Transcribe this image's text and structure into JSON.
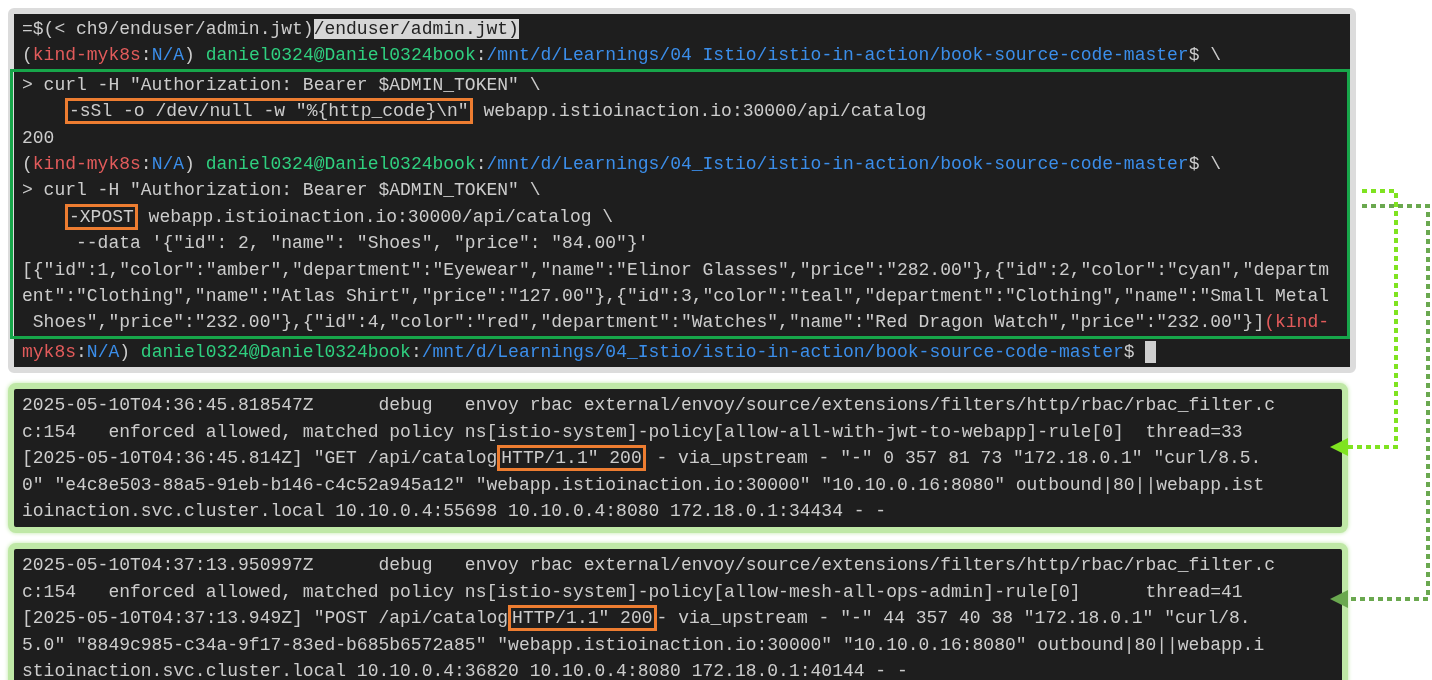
{
  "command_terminal": {
    "blocks": [
      {
        "framed": false,
        "lines": [
          [
            {
              "kind": "text",
              "text": "=$(< ch9/enduser/admin.jwt)"
            },
            {
              "kind": "selected",
              "text": "/enduser/admin.jwt)"
            }
          ],
          [
            {
              "kind": "text",
              "text": "("
            },
            {
              "kind": "env",
              "text": "kind-myk8s"
            },
            {
              "kind": "text",
              "text": ":"
            },
            {
              "kind": "ctx",
              "text": "N/A"
            },
            {
              "kind": "text",
              "text": ") "
            },
            {
              "kind": "user",
              "text": "daniel0324@Daniel0324book"
            },
            {
              "kind": "text",
              "text": ":"
            },
            {
              "kind": "path",
              "text": "/mnt/d/Learnings/04 Istio/istio-in-action/book-source-code-master"
            },
            {
              "kind": "text",
              "text": "$ \\"
            }
          ]
        ]
      },
      {
        "framed": true,
        "lines": [
          [
            {
              "kind": "text",
              "text": "> curl -H \"Authorization: Bearer $ADMIN_TOKEN\" \\"
            }
          ],
          [
            {
              "kind": "boxed",
              "text": "-sSl -o /dev/null -w \"%{http_code}\\n\""
            },
            {
              "kind": "text",
              "text": " webapp.istioinaction.io:30000/api/catalog"
            }
          ],
          [
            {
              "kind": "text",
              "text": "200"
            }
          ],
          [
            {
              "kind": "text",
              "text": "("
            },
            {
              "kind": "env",
              "text": "kind-myk8s"
            },
            {
              "kind": "text",
              "text": ":"
            },
            {
              "kind": "ctx",
              "text": "N/A"
            },
            {
              "kind": "text",
              "text": ") "
            },
            {
              "kind": "user",
              "text": "daniel0324@Daniel0324book"
            },
            {
              "kind": "text",
              "text": ":"
            },
            {
              "kind": "path",
              "text": "/mnt/d/Learnings/04_Istio/istio-in-action/book-source-code-master"
            },
            {
              "kind": "text",
              "text": "$ \\"
            }
          ],
          [
            {
              "kind": "text",
              "text": "> curl -H \"Authorization: Bearer $ADMIN_TOKEN\" \\"
            }
          ],
          [
            {
              "kind": "boxed",
              "text": "-XPOST"
            },
            {
              "kind": "text",
              "text": " webapp.istioinaction.io:30000/api/catalog \\"
            }
          ],
          [
            {
              "kind": "text",
              "text": "     --data '{\"id\": 2, \"name\": \"Shoes\", \"price\": \"84.00\"}'"
            }
          ],
          [
            {
              "kind": "text",
              "text": "[{\"id\":1,\"color\":\"amber\",\"department\":\"Eyewear\",\"name\":\"Elinor Glasses\",\"price\":\"282.00\"},{\"id\":2,\"color\":\"cyan\",\"departm"
            }
          ],
          [
            {
              "kind": "text",
              "text": "ent\":\"Clothing\",\"name\":\"Atlas Shirt\",\"price\":\"127.00\"},{\"id\":3,\"color\":\"teal\",\"department\":\"Clothing\",\"name\":\"Small Metal"
            }
          ],
          [
            {
              "kind": "text",
              "text": " Shoes\",\"price\":\"232.00\"},{\"id\":4,\"color\":\"red\",\"department\":\"Watches\",\"name\":\"Red Dragon Watch\",\"price\":\"232.00\"}]"
            },
            {
              "kind": "env",
              "text": "(kind-"
            }
          ]
        ]
      },
      {
        "framed": false,
        "lines": [
          [
            {
              "kind": "env",
              "text": "myk8s"
            },
            {
              "kind": "text",
              "text": ":"
            },
            {
              "kind": "ctx",
              "text": "N/A"
            },
            {
              "kind": "text",
              "text": ") "
            },
            {
              "kind": "user",
              "text": "daniel0324@Daniel0324book"
            },
            {
              "kind": "text",
              "text": ":"
            },
            {
              "kind": "path",
              "text": "/mnt/d/Learnings/04_Istio/istio-in-action/book-source-code-master"
            },
            {
              "kind": "text",
              "text": "$ "
            },
            {
              "kind": "cursor"
            }
          ]
        ]
      }
    ]
  },
  "log_panels": [
    {
      "lines": [
        [
          {
            "kind": "text",
            "text": "2025-05-10T04:36:45.818547Z      debug   envoy rbac external/envoy/source/extensions/filters/http/rbac/rbac_filter.c"
          }
        ],
        [
          {
            "kind": "text",
            "text": "c:154   enforced allowed, matched policy ns[istio-system]-policy[allow-all-with-jwt-to-webapp]-rule[0]  thread=33"
          }
        ],
        [
          {
            "kind": "text",
            "text": "[2025-05-10T04:36:45.814Z] \"GET /api/catalog"
          },
          {
            "kind": "boxed",
            "text": "HTTP/1.1\" 200"
          },
          {
            "kind": "text",
            "text": " - via_upstream - \"-\" 0 357 81 73 \"172.18.0.1\" \"curl/8.5."
          }
        ],
        [
          {
            "kind": "text",
            "text": "0\" \"e4c8e503-88a5-91eb-b146-c4c52a945a12\" \"webapp.istioinaction.io:30000\" \"10.10.0.16:8080\" outbound|80||webapp.ist"
          }
        ],
        [
          {
            "kind": "text",
            "text": "ioinaction.svc.cluster.local 10.10.0.4:55698 10.10.0.4:8080 172.18.0.1:34434 - -"
          }
        ]
      ]
    },
    {
      "lines": [
        [
          {
            "kind": "text",
            "text": "2025-05-10T04:37:13.950997Z      debug   envoy rbac external/envoy/source/extensions/filters/http/rbac/rbac_filter.c"
          }
        ],
        [
          {
            "kind": "text",
            "text": "c:154   enforced allowed, matched policy ns[istio-system]-policy[allow-mesh-all-ops-admin]-rule[0]      thread=41"
          }
        ],
        [
          {
            "kind": "text",
            "text": "[2025-05-10T04:37:13.949Z] \"POST /api/catalog"
          },
          {
            "kind": "boxed",
            "text": "HTTP/1.1\" 200"
          },
          {
            "kind": "text",
            "text": "- via_upstream - \"-\" 44 357 40 38 \"172.18.0.1\" \"curl/8."
          }
        ],
        [
          {
            "kind": "text",
            "text": "5.0\" \"8849c985-c34a-9f17-83ed-b685b6572a85\" \"webapp.istioinaction.io:30000\" \"10.10.0.16:8080\" outbound|80||webapp.i"
          }
        ],
        [
          {
            "kind": "text",
            "text": "stioinaction.svc.cluster.local 10.10.0.4:36820 10.10.0.4:8080 172.18.0.1:40144 - -"
          }
        ]
      ]
    }
  ]
}
